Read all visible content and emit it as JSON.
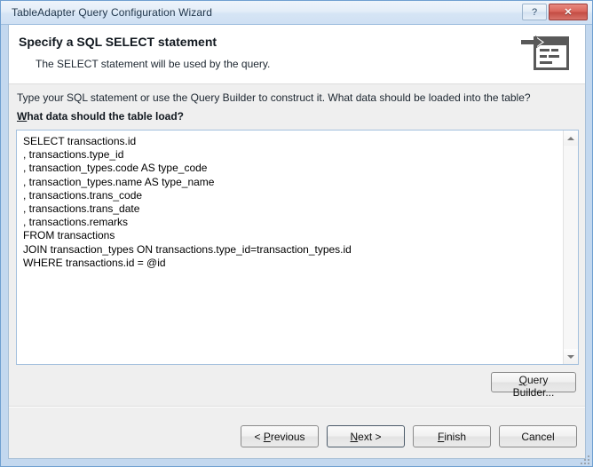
{
  "window": {
    "title": "TableAdapter Query Configuration Wizard",
    "help_button": "?",
    "close_button": "✕",
    "border_color": "#6f9fd0"
  },
  "header": {
    "title": "Specify a SQL SELECT statement",
    "subtitle": "The SELECT statement will be used by the query.",
    "icon": "sql-select-statement-icon"
  },
  "main": {
    "instruction": "Type your SQL statement or use the Query Builder to construct it. What data should be loaded into the table?",
    "field_label_accel": "W",
    "field_label_rest": "hat data should the table load?",
    "sql_statement": "SELECT transactions.id\n, transactions.type_id\n, transaction_types.code AS type_code\n, transaction_types.name AS type_name\n, transactions.trans_code\n, transactions.trans_date\n, transactions.remarks\nFROM transactions\nJOIN transaction_types ON transactions.type_id=transaction_types.id\nWHERE transactions.id = @id",
    "scrollbar": {
      "up_icon": "scroll-up-arrow-icon",
      "down_icon": "scroll-down-arrow-icon"
    },
    "query_builder_accel": "Q",
    "query_builder_rest": "uery Builder..."
  },
  "footer": {
    "previous_prefix": "< ",
    "previous_accel": "P",
    "previous_rest": "revious",
    "next_accel": "N",
    "next_rest": "ext >",
    "finish_accel": "F",
    "finish_rest": "inish",
    "cancel_label": "Cancel"
  }
}
